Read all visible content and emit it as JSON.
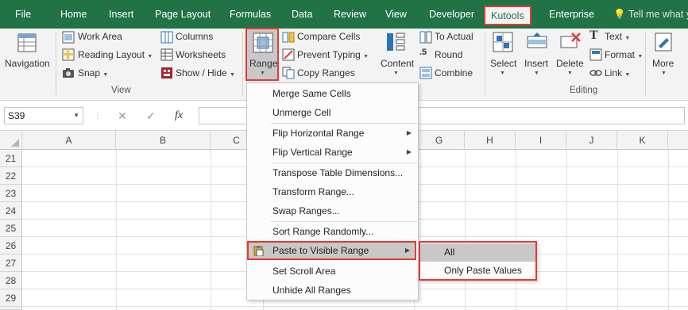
{
  "tabs": {
    "file": "File",
    "home": "Home",
    "insert": "Insert",
    "page_layout": "Page Layout",
    "formulas": "Formulas",
    "data": "Data",
    "review": "Review",
    "view": "View",
    "developer": "Developer",
    "kutools": "Kutools",
    "enterprise": "Enterprise",
    "tell_me": "Tell me what y"
  },
  "ribbon": {
    "navigation": "Navigation",
    "work_area": "Work Area",
    "reading_layout": "Reading Layout",
    "snap": "Snap",
    "columns": "Columns",
    "worksheets": "Worksheets",
    "show_hide": "Show / Hide",
    "view_group": "View",
    "range": "Range",
    "compare_cells": "Compare Cells",
    "prevent_typing": "Prevent Typing",
    "copy_ranges": "Copy Ranges",
    "content": "Content",
    "to_actual": "To Actual",
    "round": "Round",
    "combine": "Combine",
    "select": "Select",
    "insert": "Insert",
    "delete": "Delete",
    "text": "Text",
    "format": "Format",
    "link": "Link",
    "more": "More",
    "editing_group": "Editing"
  },
  "formula_bar": {
    "name_box": "S39",
    "cancel": "✕",
    "confirm": "✓",
    "fx": "fx"
  },
  "grid": {
    "columns": [
      "A",
      "B",
      "C",
      "G",
      "H",
      "I",
      "J",
      "K"
    ],
    "rows": [
      "21",
      "22",
      "23",
      "24",
      "25",
      "26",
      "27",
      "28",
      "29"
    ]
  },
  "range_menu": {
    "items": [
      "Merge Same Cells",
      "Unmerge Cell",
      "Flip Horizontal Range",
      "Flip Vertical Range",
      "Transpose Table Dimensions...",
      "Transform Range...",
      "Swap Ranges...",
      "Sort Range Randomly...",
      "Paste to Visible Range",
      "Set Scroll Area",
      "Unhide All Ranges"
    ]
  },
  "paste_submenu": {
    "items": [
      "All",
      "Only Paste Values"
    ]
  },
  "colors": {
    "excel_green": "#217346",
    "highlight_red": "#e53935",
    "ribbon_bg": "#f3f3f3"
  }
}
